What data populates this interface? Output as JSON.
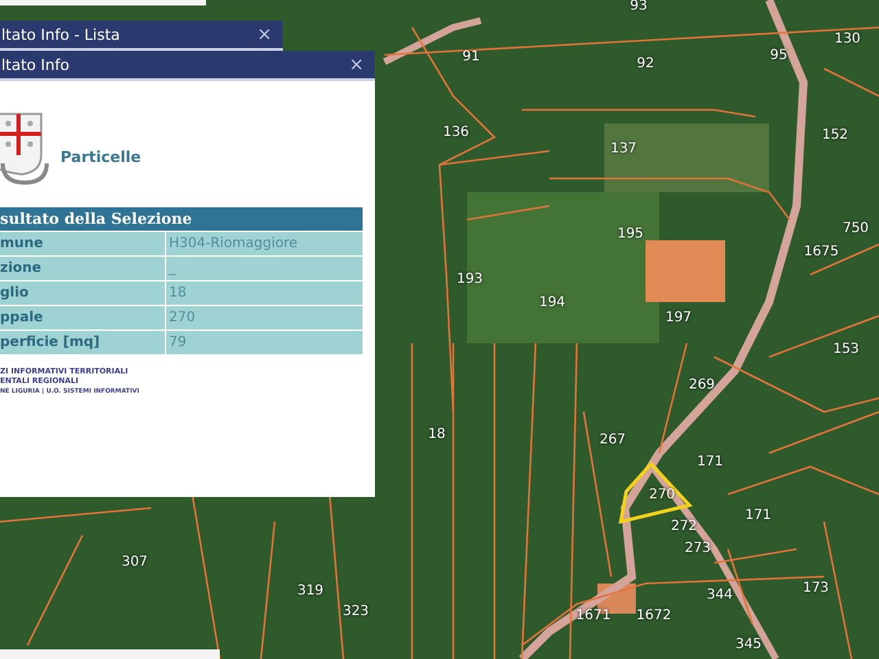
{
  "map": {
    "parcels": [
      {
        "label": "93",
        "selected": false
      },
      {
        "label": "91",
        "selected": false
      },
      {
        "label": "92",
        "selected": false
      },
      {
        "label": "95",
        "selected": false
      },
      {
        "label": "130",
        "selected": false
      },
      {
        "label": "136",
        "selected": false
      },
      {
        "label": "137",
        "selected": false
      },
      {
        "label": "152",
        "selected": false
      },
      {
        "label": "195",
        "selected": false
      },
      {
        "label": "750",
        "selected": false
      },
      {
        "label": "1675",
        "selected": false
      },
      {
        "label": "193",
        "selected": false
      },
      {
        "label": "194",
        "selected": false
      },
      {
        "label": "197",
        "selected": false
      },
      {
        "label": "153",
        "selected": false
      },
      {
        "label": "269",
        "selected": false
      },
      {
        "label": "18",
        "selected": false
      },
      {
        "label": "267",
        "selected": false
      },
      {
        "label": "171",
        "selected": false
      },
      {
        "label": "270",
        "selected": true
      },
      {
        "label": "171",
        "selected": false
      },
      {
        "label": "272",
        "selected": false
      },
      {
        "label": "273",
        "selected": false
      },
      {
        "label": "173",
        "selected": false
      },
      {
        "label": "344",
        "selected": false
      },
      {
        "label": "1671",
        "selected": false
      },
      {
        "label": "1672",
        "selected": false
      },
      {
        "label": "345",
        "selected": false
      },
      {
        "label": "307",
        "selected": false
      },
      {
        "label": "319",
        "selected": false
      },
      {
        "label": "323",
        "selected": false
      }
    ]
  },
  "list_window": {
    "title": "ltato Info - Lista",
    "close": "×"
  },
  "info_window": {
    "title": "ltato Info",
    "close": "×",
    "layer": "Particelle",
    "table": {
      "title": "sultato della Selezione",
      "rows": [
        {
          "label": "mune",
          "value": "H304-Riomaggiore"
        },
        {
          "label": "zione",
          "value": "_"
        },
        {
          "label": "glio",
          "value": "18"
        },
        {
          "label": "ppale",
          "value": "270"
        },
        {
          "label": "perficie [mq]",
          "value": "79"
        }
      ]
    },
    "footer": [
      "ZI INFORMATIVI TERRITORIALI",
      "ENTALI REGIONALI",
      "NE LIGURIA | U.O. SISTEMI INFORMATIVI"
    ]
  }
}
